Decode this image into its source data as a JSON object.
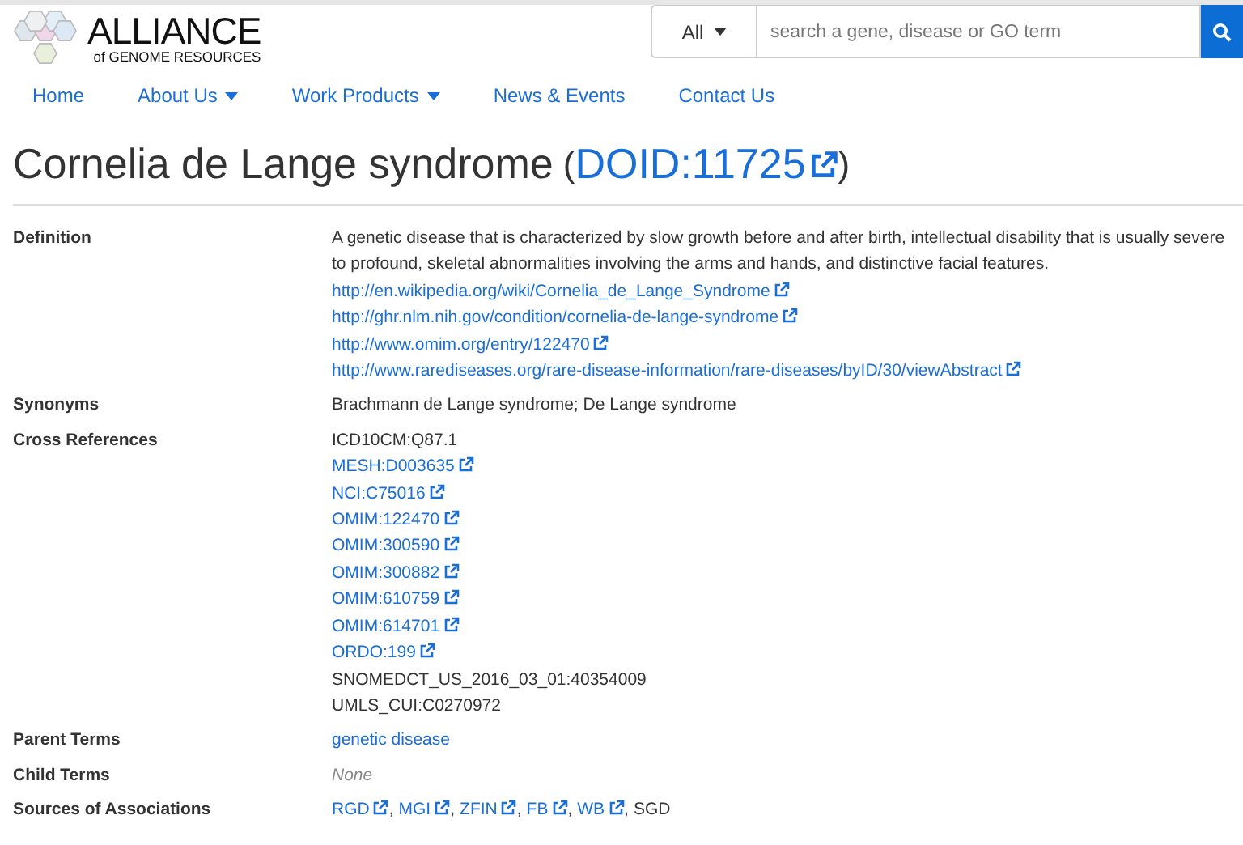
{
  "logo": {
    "title": "ALLIANCE",
    "subtitle": "of GENOME RESOURCES"
  },
  "search": {
    "category": "All",
    "placeholder": "search a gene, disease or GO term"
  },
  "nav": [
    {
      "label": "Home",
      "dropdown": false
    },
    {
      "label": "About Us",
      "dropdown": true
    },
    {
      "label": "Work Products",
      "dropdown": true
    },
    {
      "label": "News & Events",
      "dropdown": false
    },
    {
      "label": "Contact Us",
      "dropdown": false
    }
  ],
  "page_title": {
    "name": "Cornelia de Lange syndrome",
    "open": "(",
    "id": "DOID:11725",
    "close": ")"
  },
  "rows": [
    {
      "label": "Definition",
      "kind": "definition",
      "text": "A genetic disease that is characterized by slow growth before and after birth, intellectual disability that is usually severe to profound, skeletal abnormalities involving the arms and hands, and distinctive facial features.",
      "links": [
        "http://en.wikipedia.org/wiki/Cornelia_de_Lange_Syndrome",
        "http://ghr.nlm.nih.gov/condition/cornelia-de-lange-syndrome",
        "http://www.omim.org/entry/122470",
        "http://www.rarediseases.org/rare-disease-information/rare-diseases/byID/30/viewAbstract"
      ]
    },
    {
      "label": "Synonyms",
      "kind": "text",
      "text": "Brachmann de Lange syndrome; De Lange syndrome"
    },
    {
      "label": "Cross References",
      "kind": "list",
      "items": [
        {
          "text": "ICD10CM:Q87.1",
          "kind": "text"
        },
        {
          "text": "MESH:D003635",
          "kind": "link"
        },
        {
          "text": "NCI:C75016",
          "kind": "link"
        },
        {
          "text": "OMIM:122470",
          "kind": "link"
        },
        {
          "text": "OMIM:300590",
          "kind": "link"
        },
        {
          "text": "OMIM:300882",
          "kind": "link"
        },
        {
          "text": "OMIM:610759",
          "kind": "link"
        },
        {
          "text": "OMIM:614701",
          "kind": "link"
        },
        {
          "text": "ORDO:199",
          "kind": "link"
        },
        {
          "text": "SNOMEDCT_US_2016_03_01:40354009",
          "kind": "text"
        },
        {
          "text": "UMLS_CUI:C0270972",
          "kind": "text"
        }
      ]
    },
    {
      "label": "Parent Terms",
      "kind": "term",
      "text": "genetic disease"
    },
    {
      "label": "Child Terms",
      "kind": "none",
      "text": "None"
    },
    {
      "label": "Sources of Associations",
      "kind": "inline",
      "separator": ",",
      "items": [
        {
          "text": "RGD",
          "kind": "link"
        },
        {
          "text": "MGI",
          "kind": "link"
        },
        {
          "text": "ZFIN",
          "kind": "link"
        },
        {
          "text": "FB",
          "kind": "link"
        },
        {
          "text": "WB",
          "kind": "link"
        },
        {
          "text": "SGD",
          "kind": "text"
        }
      ]
    }
  ]
}
